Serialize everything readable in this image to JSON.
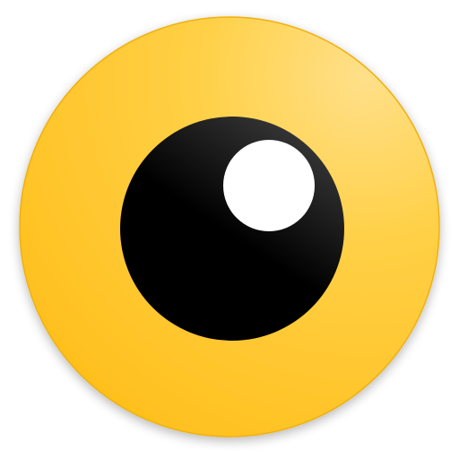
{
  "icon": {
    "name": "eye-icon",
    "colors": {
      "background": "#ffffff",
      "iris_light": "#FFE08A",
      "iris_mid": "#FFD046",
      "iris_dark": "#FFBE19",
      "iris_rim": "#F0B00E",
      "pupil_light": "#3a3a3a",
      "pupil_dark": "#000000",
      "highlight": "#ffffff"
    }
  }
}
